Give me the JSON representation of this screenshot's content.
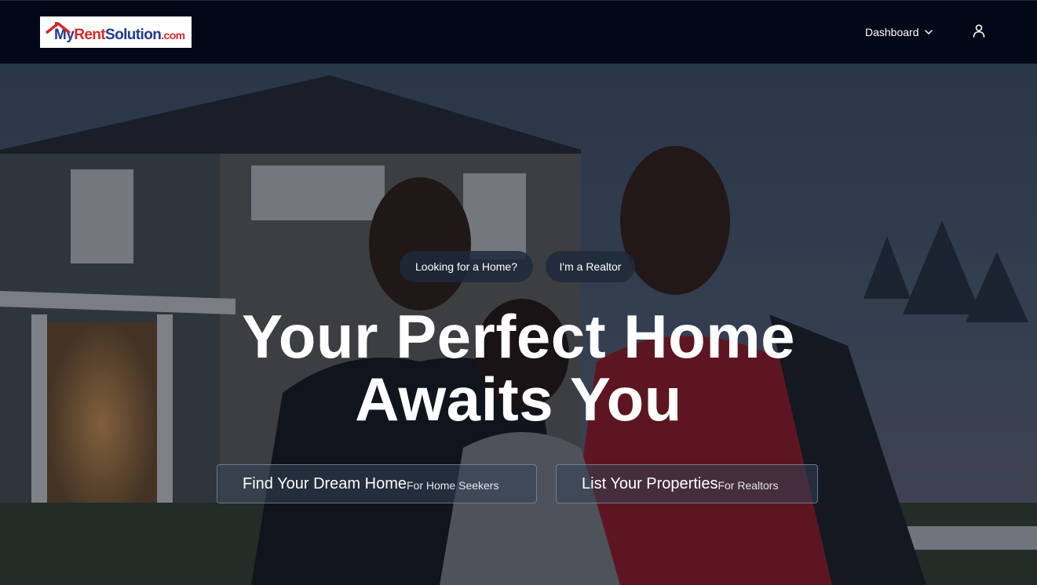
{
  "brand": {
    "logo_my": "My",
    "logo_rent": "Rent",
    "logo_solution": "Solution",
    "logo_com": ".com",
    "colors": {
      "navy": "#1f3a93",
      "red": "#d62828"
    }
  },
  "nav": {
    "dashboard_label": "Dashboard",
    "dashboard_icon": "chevron-down-icon",
    "user_icon": "user-icon",
    "background": "#020817"
  },
  "hero": {
    "toggle": {
      "home_seeker_label": "Looking for a Home?",
      "realtor_label": "I'm a Realtor"
    },
    "headline_line1": "Your Perfect Home",
    "headline_line2": "Awaits You",
    "cta_find": {
      "label": "Find Your Dream Home",
      "sublabel": "For Home Seekers"
    },
    "cta_list": {
      "label": "List Your Properties",
      "sublabel": "For Realtors"
    }
  }
}
